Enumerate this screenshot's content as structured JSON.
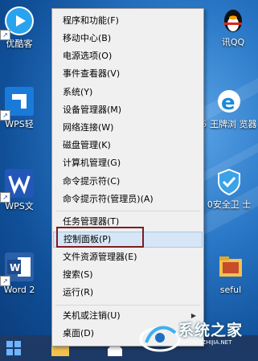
{
  "desktop": {
    "icons": [
      {
        "label": "优酷客"
      },
      {
        "label": "WPS轻"
      },
      {
        "label": "WPS文"
      },
      {
        "label": "Word 2"
      },
      {
        "label": "讯QQ"
      },
      {
        "label": "5 王牌浏 览器"
      },
      {
        "label": "0安全卫 士"
      },
      {
        "label": "seful"
      }
    ]
  },
  "context_menu": {
    "items": [
      {
        "label": "程序和功能(F)"
      },
      {
        "label": "移动中心(B)"
      },
      {
        "label": "电源选项(O)"
      },
      {
        "label": "事件查看器(V)"
      },
      {
        "label": "系统(Y)"
      },
      {
        "label": "设备管理器(M)"
      },
      {
        "label": "网络连接(W)"
      },
      {
        "label": "磁盘管理(K)"
      },
      {
        "label": "计算机管理(G)"
      },
      {
        "label": "命令提示符(C)"
      },
      {
        "label": "命令提示符(管理员)(A)"
      },
      {
        "label": "任务管理器(T)"
      },
      {
        "label": "控制面板(P)"
      },
      {
        "label": "文件资源管理器(E)"
      },
      {
        "label": "搜索(S)"
      },
      {
        "label": "运行(R)"
      },
      {
        "label": "关机或注销(U)"
      },
      {
        "label": "桌面(D)"
      }
    ],
    "highlighted": "控制面板(P)"
  },
  "watermark": {
    "title": "系统之家",
    "url": "XITONGZHIJIA.NET"
  },
  "colors": {
    "highlight_bg": "#d6e6f7",
    "annotation_border": "#7d1e1e",
    "menu_bg": "#f0f0f0"
  }
}
